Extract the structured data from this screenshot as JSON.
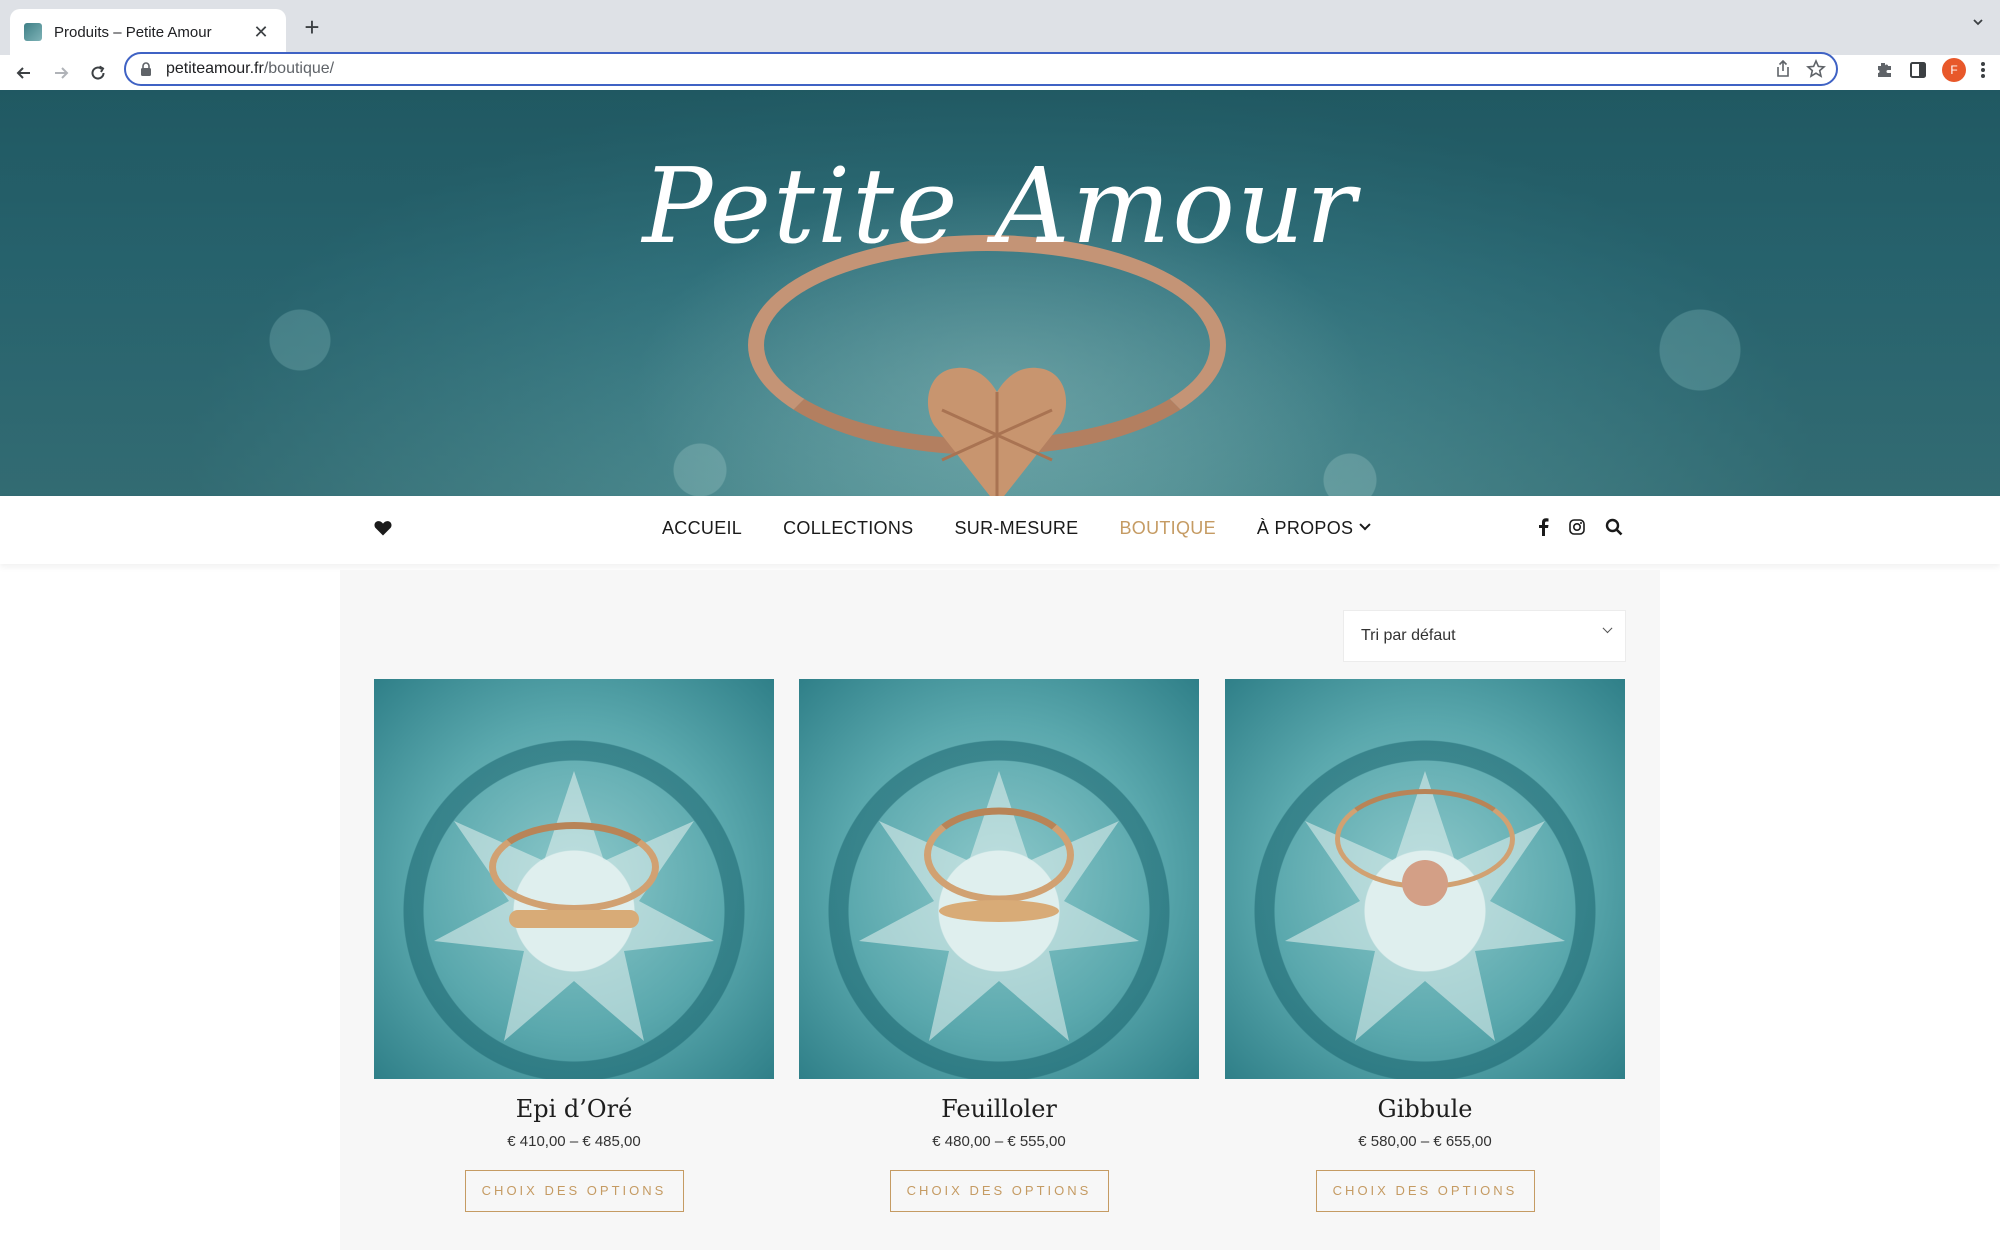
{
  "browser": {
    "tab_title": "Produits – Petite Amour",
    "tab_close": "✕",
    "new_tab": "+",
    "url_host": "petiteamour.fr",
    "url_path": "/boutique/",
    "avatar_letter": "F"
  },
  "hero": {
    "logo_text": "Petite Amour"
  },
  "nav": {
    "items": [
      {
        "label": "ACCUEIL"
      },
      {
        "label": "COLLECTIONS"
      },
      {
        "label": "SUR-MESURE"
      },
      {
        "label": "BOUTIQUE",
        "active": true
      },
      {
        "label": "À PROPOS"
      }
    ],
    "accent_color": "#c59b63"
  },
  "shop": {
    "sort_label": "Tri par défaut",
    "products": [
      {
        "name": "Epi d’Oré",
        "price": "€ 410,00 – € 485,00",
        "button": "CHOIX DES OPTIONS"
      },
      {
        "name": "Feuilloler",
        "price": "€ 480,00 – € 555,00",
        "button": "CHOIX DES OPTIONS"
      },
      {
        "name": "Gibbule",
        "price": "€ 580,00 – € 655,00",
        "button": "CHOIX DES OPTIONS"
      }
    ]
  }
}
